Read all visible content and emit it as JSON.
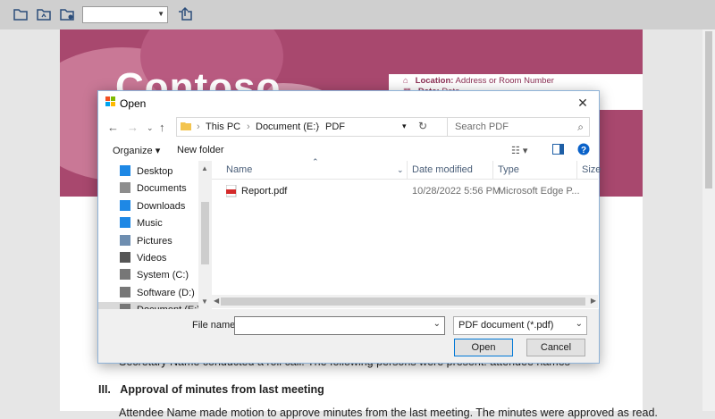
{
  "document": {
    "logo_text": "Contoso",
    "location_label": "Location:",
    "location_value": "Address or Room Number",
    "date_label": "Date:",
    "date_value": "Date",
    "line1": "Secretary Name conducted a roll call. The following persons were present: attendee names",
    "section3": "III.   Approval of minutes from last meeting",
    "line2": "Attendee Name made motion to approve minutes from the last meeting. The minutes were approved as read."
  },
  "dialog": {
    "title": "Open",
    "breadcrumb": [
      "This PC",
      "Document (E:)",
      "PDF"
    ],
    "search_placeholder": "Search PDF",
    "organize_label": "Organize",
    "new_folder_label": "New folder",
    "nav_items": [
      {
        "label": "Desktop",
        "icon": "desktop-icon",
        "color": "#1e88e5"
      },
      {
        "label": "Documents",
        "icon": "documents-icon",
        "color": "#8d8d8d"
      },
      {
        "label": "Downloads",
        "icon": "downloads-icon",
        "color": "#1e88e5"
      },
      {
        "label": "Music",
        "icon": "music-icon",
        "color": "#1e88e5"
      },
      {
        "label": "Pictures",
        "icon": "pictures-icon",
        "color": "#6e8eb0"
      },
      {
        "label": "Videos",
        "icon": "videos-icon",
        "color": "#555555"
      },
      {
        "label": "System (C:)",
        "icon": "drive-icon",
        "color": "#777777"
      },
      {
        "label": "Software (D:)",
        "icon": "drive-icon",
        "color": "#777777"
      },
      {
        "label": "Document (E:)",
        "icon": "drive-icon",
        "color": "#777777"
      }
    ],
    "columns": [
      "Name",
      "Date modified",
      "Type",
      "Size"
    ],
    "files": [
      {
        "name": "Report.pdf",
        "date": "10/28/2022 5:56 PM",
        "type": "Microsoft Edge P..."
      }
    ],
    "file_name_label": "File name:",
    "file_name_value": "",
    "file_type": "PDF document (*.pdf)",
    "open_label": "Open",
    "cancel_label": "Cancel"
  },
  "colors": {
    "banner": "#a8486e",
    "accent": "#0078d7"
  }
}
